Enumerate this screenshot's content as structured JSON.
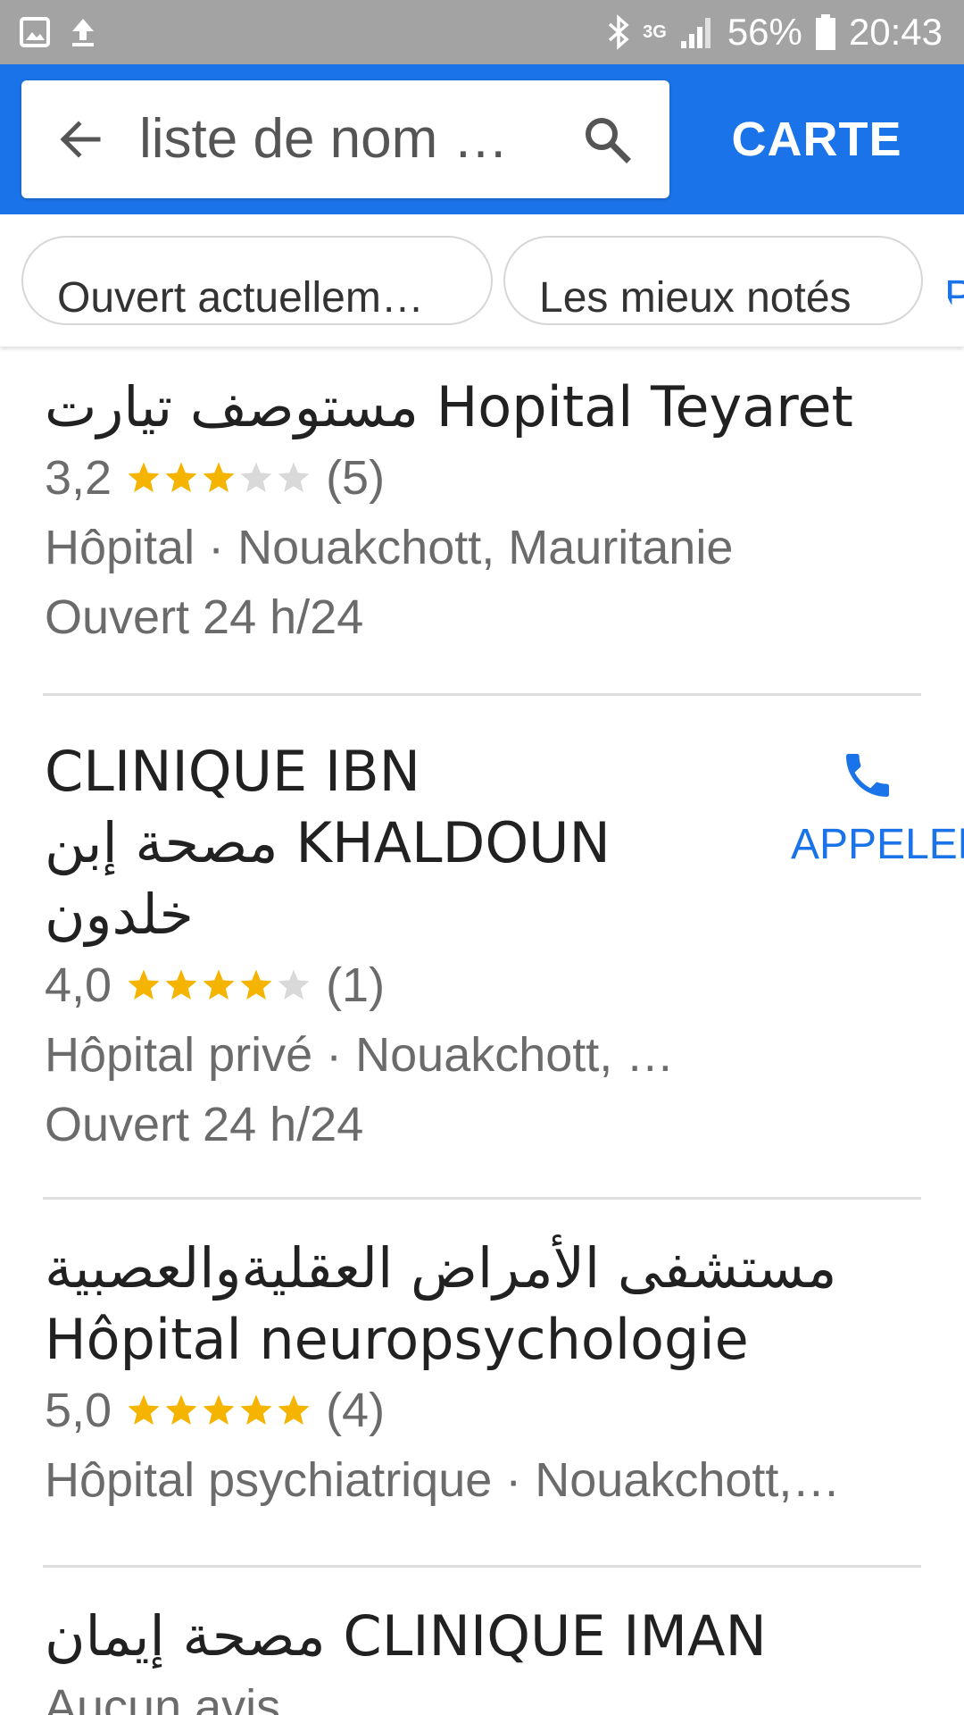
{
  "status_bar": {
    "network": "3G",
    "battery": "56%",
    "time": "20:43",
    "icons": [
      "image-icon",
      "upload-icon",
      "bluetooth-icon",
      "signal-icon",
      "battery-icon"
    ]
  },
  "app_bar": {
    "search_query": "liste de nom …",
    "map_button": "CARTE",
    "accent_color": "#1a73e8"
  },
  "filters": {
    "chips": [
      "Ouvert actuellem…",
      "Les mieux notés",
      "P"
    ]
  },
  "results": [
    {
      "title_ar": "مستوصف تيارت",
      "title_fr": "Hopital Teyaret",
      "rating": "3,2",
      "stars_filled": 3,
      "reviews": "(5)",
      "category_location": "Hôpital · Nouakchott, Mauritanie",
      "hours": "Ouvert 24 h/24"
    },
    {
      "title_line1": "CLINIQUE IBN",
      "title_line2_ar": "مصحة إبن",
      "title_line2_fr": "KHALDOUN",
      "title_line3_ar": "خلدون",
      "rating": "4,0",
      "stars_filled": 4,
      "reviews": "(1)",
      "category_location": "Hôpital privé · Nouakchott, …",
      "hours": "Ouvert 24 h/24",
      "call_label": "APPELER"
    },
    {
      "title_ar": "مستشفى الأمراض العقليةوالعصبية",
      "title_fr": "Hôpital neuropsychologie",
      "rating": "5,0",
      "stars_filled": 5,
      "reviews": "(4)",
      "category_location": "Hôpital psychiatrique · Nouakchott,…"
    },
    {
      "title_ar": "مصحة إيمان",
      "title_fr": "CLINIQUE IMAN",
      "rating_text": "Aucun avis"
    }
  ]
}
